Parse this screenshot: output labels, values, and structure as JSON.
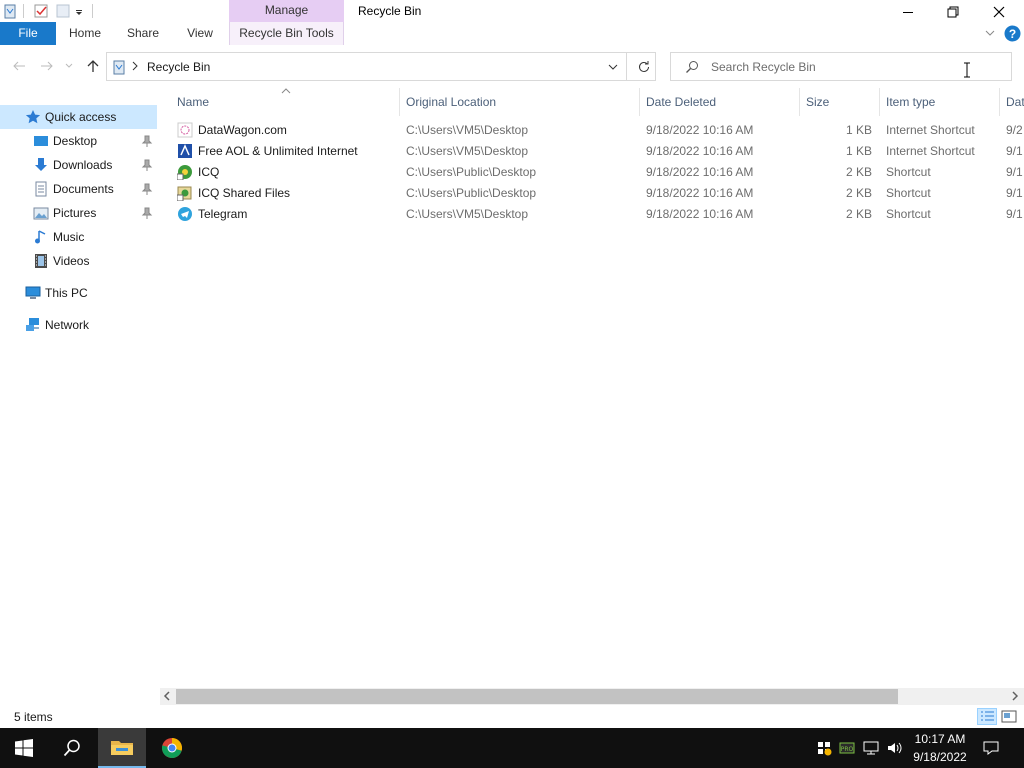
{
  "titlebar": {
    "context_tab": "Manage",
    "title": "Recycle Bin"
  },
  "ribbon": {
    "tabs": [
      "File",
      "Home",
      "Share",
      "View",
      "Recycle Bin Tools"
    ]
  },
  "address": {
    "path": "Recycle Bin"
  },
  "search": {
    "placeholder": "Search Recycle Bin"
  },
  "navpane": {
    "items": [
      {
        "label": "Quick access",
        "icon": "star-icon"
      },
      {
        "label": "Desktop",
        "icon": "desktop-icon",
        "pinned": true
      },
      {
        "label": "Downloads",
        "icon": "download-icon",
        "pinned": true
      },
      {
        "label": "Documents",
        "icon": "documents-icon",
        "pinned": true
      },
      {
        "label": "Pictures",
        "icon": "pictures-icon",
        "pinned": true
      },
      {
        "label": "Music",
        "icon": "music-icon"
      },
      {
        "label": "Videos",
        "icon": "videos-icon"
      },
      {
        "label": "This PC",
        "icon": "computer-icon"
      },
      {
        "label": "Network",
        "icon": "network-icon"
      }
    ]
  },
  "columns": [
    "Name",
    "Original Location",
    "Date Deleted",
    "Size",
    "Item type",
    "Dat"
  ],
  "files": [
    {
      "name": "DataWagon.com",
      "location": "C:\\Users\\VM5\\Desktop",
      "date": "9/18/2022 10:16 AM",
      "size": "1 KB",
      "type": "Internet Shortcut",
      "extra": "9/2",
      "icon": "datawagon-icon"
    },
    {
      "name": "Free AOL & Unlimited Internet",
      "location": "C:\\Users\\VM5\\Desktop",
      "date": "9/18/2022 10:16 AM",
      "size": "1 KB",
      "type": "Internet Shortcut",
      "extra": "9/1",
      "icon": "aol-icon"
    },
    {
      "name": "ICQ",
      "location": "C:\\Users\\Public\\Desktop",
      "date": "9/18/2022 10:16 AM",
      "size": "2 KB",
      "type": "Shortcut",
      "extra": "9/1",
      "icon": "icq-icon"
    },
    {
      "name": "ICQ Shared Files",
      "location": "C:\\Users\\Public\\Desktop",
      "date": "9/18/2022 10:16 AM",
      "size": "2 KB",
      "type": "Shortcut",
      "extra": "9/1",
      "icon": "icq-shared-icon"
    },
    {
      "name": "Telegram",
      "location": "C:\\Users\\VM5\\Desktop",
      "date": "9/18/2022 10:16 AM",
      "size": "2 KB",
      "type": "Shortcut",
      "extra": "9/1",
      "icon": "telegram-icon"
    }
  ],
  "status": {
    "item_count": "5 items"
  },
  "taskbar": {
    "time": "10:17 AM",
    "date": "9/18/2022"
  },
  "colors": {
    "accent": "#1979ca",
    "selection": "#cce8ff",
    "manage_tab": "#e6cdf3",
    "taskbar": "#101010"
  }
}
